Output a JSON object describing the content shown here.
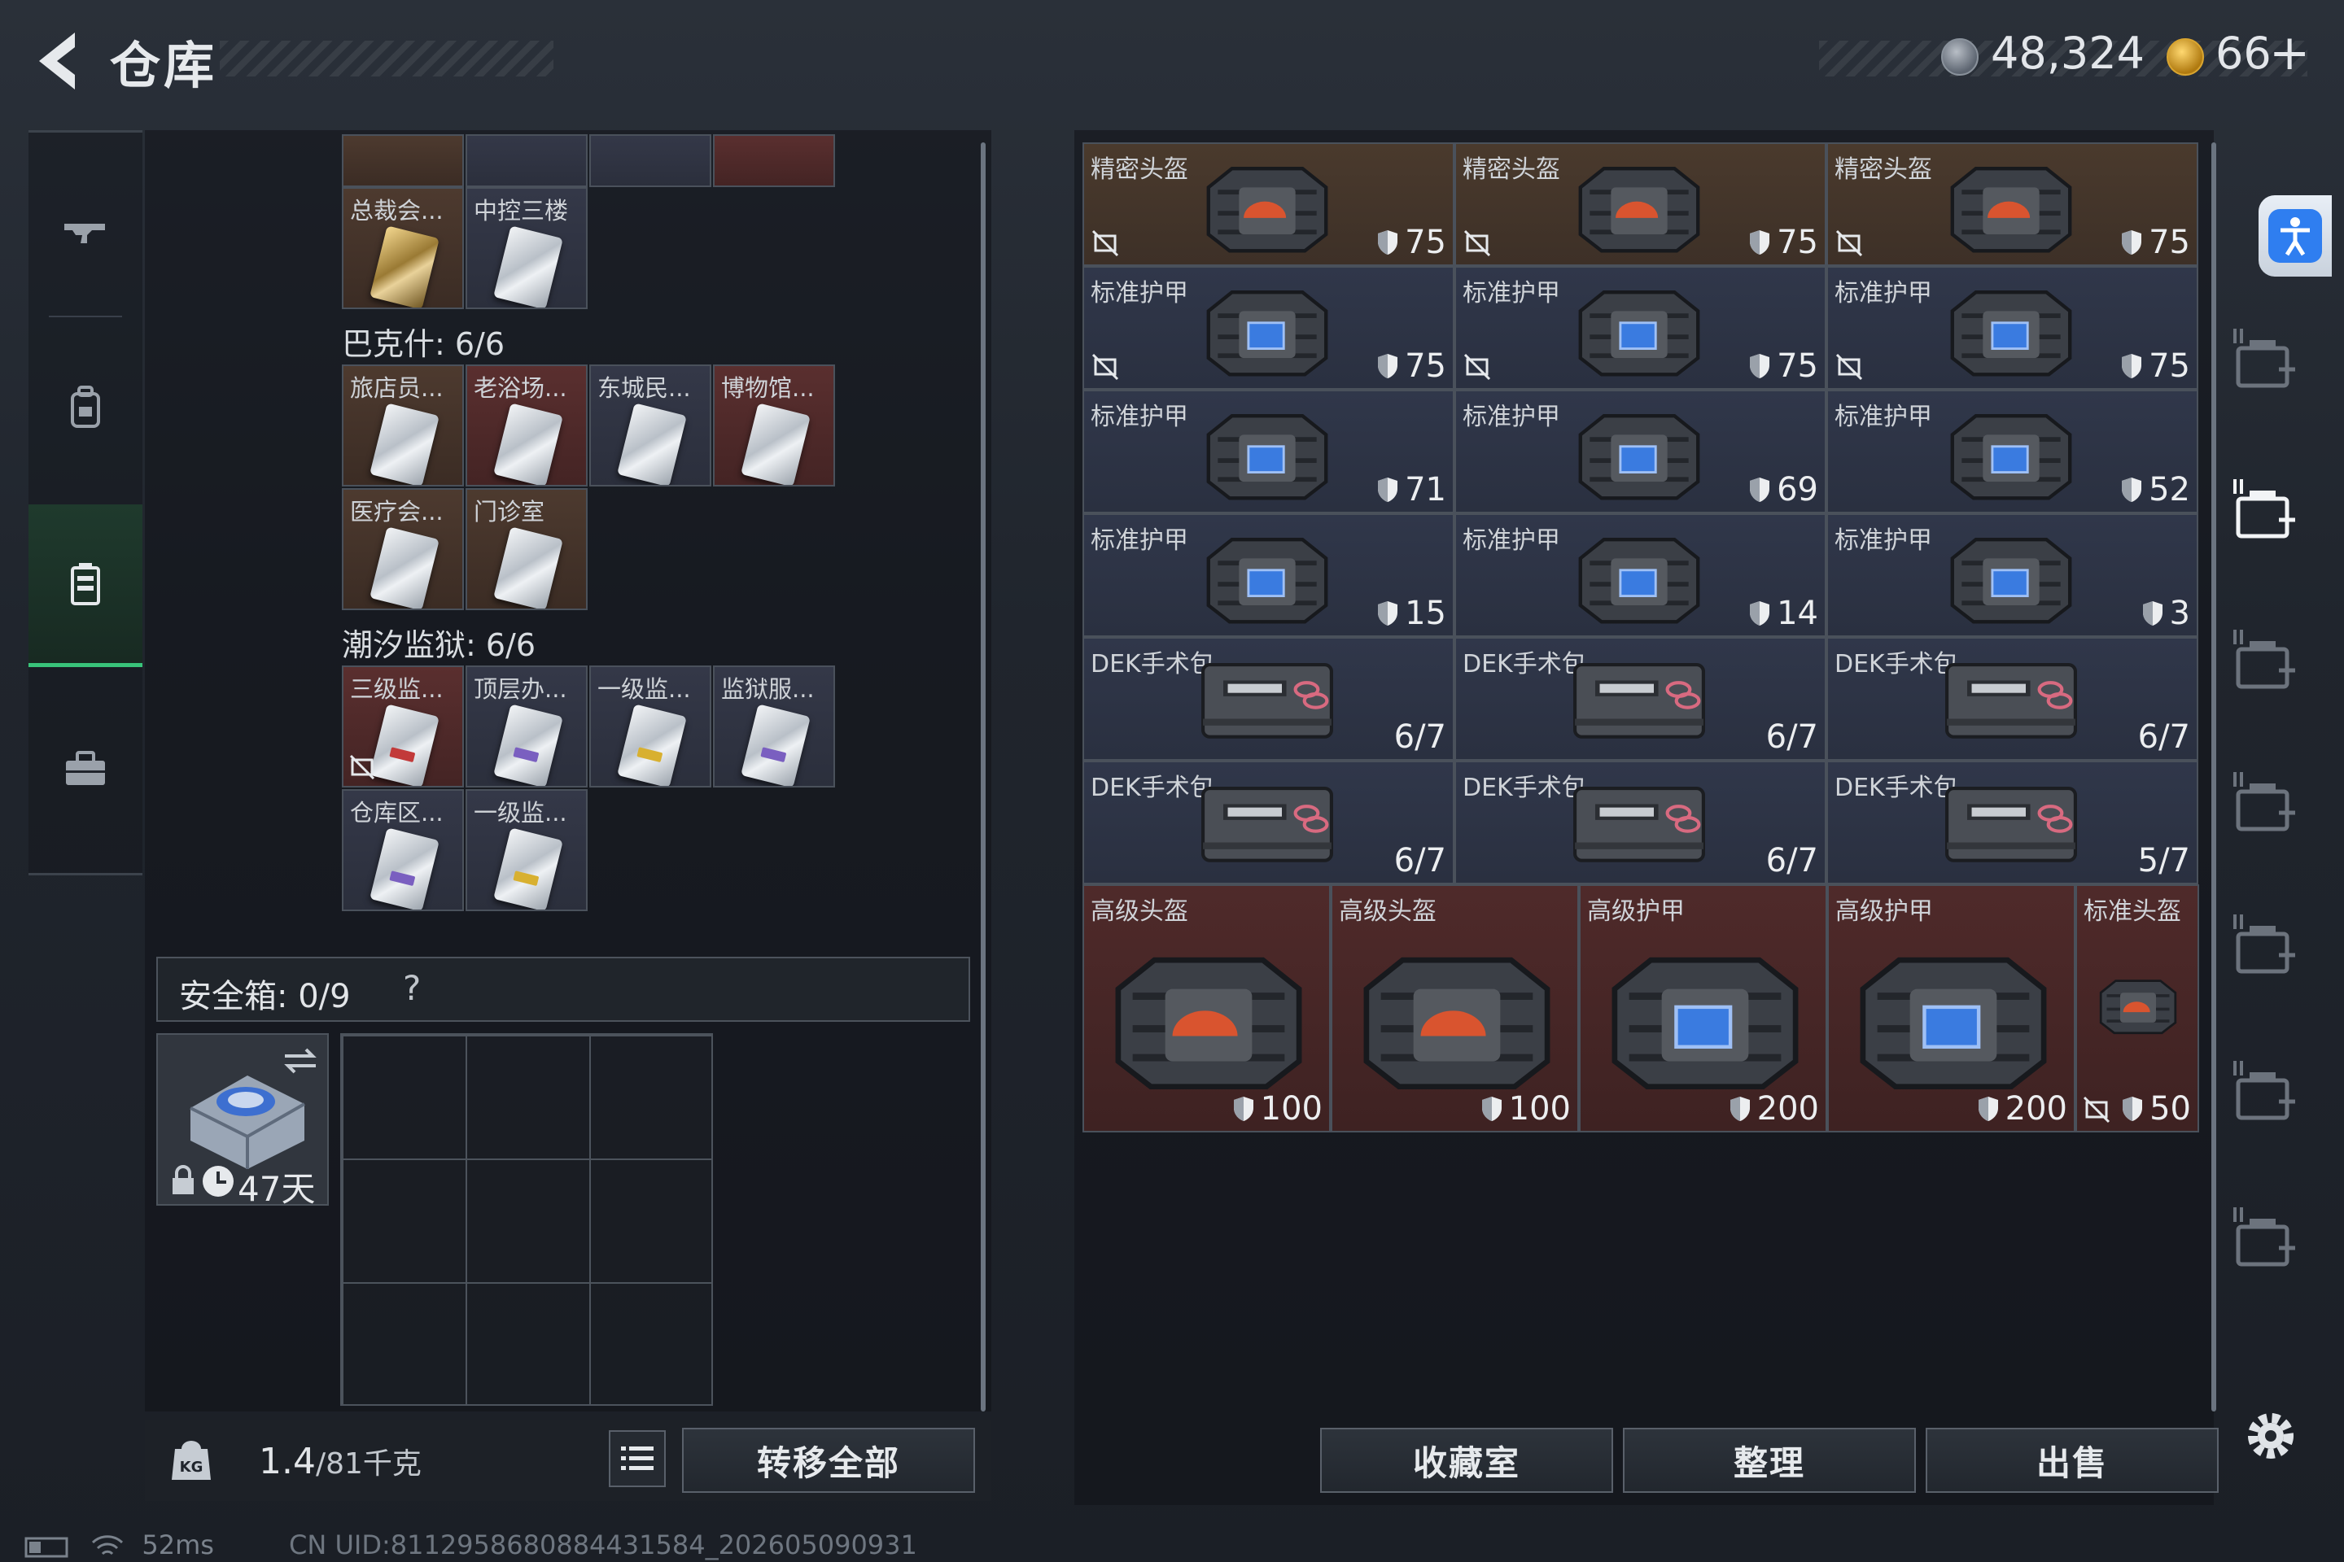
{
  "header": {
    "title": "仓库",
    "currency1": "48,324",
    "currency2": "66",
    "plus_label": "+"
  },
  "left_groups": [
    {
      "title": "",
      "items": [
        {
          "label": "总裁会...",
          "card": "gold",
          "bg": "brown"
        },
        {
          "label": "中控三楼",
          "card": "silver",
          "bg": "blue"
        }
      ]
    },
    {
      "title": "巴克什: 6/6",
      "items": [
        {
          "label": "旅店员...",
          "bg": "brown"
        },
        {
          "label": "老浴场...",
          "bg": "red"
        },
        {
          "label": "东城民...",
          "bg": "blue"
        },
        {
          "label": "博物馆...",
          "bg": "red"
        },
        {
          "label": "医疗会...",
          "bg": "brown"
        },
        {
          "label": "门诊室",
          "bg": "brown"
        }
      ]
    },
    {
      "title": "潮汐监狱: 6/6",
      "items": [
        {
          "label": "三级监...",
          "bg": "red"
        },
        {
          "label": "顶层办...",
          "bg": "blue"
        },
        {
          "label": "一级监...",
          "bg": "blue"
        },
        {
          "label": "监狱服...",
          "bg": "blue"
        },
        {
          "label": "仓库区...",
          "bg": "blue"
        },
        {
          "label": "一级监...",
          "bg": "blue"
        }
      ]
    }
  ],
  "safe_box": {
    "label": "安全箱: 0/9",
    "help": "?",
    "days": "47天"
  },
  "weight": {
    "current": "1.4",
    "max": "/81千克"
  },
  "buttons": {
    "transfer_all": "转移全部",
    "collection": "收藏室",
    "organize": "整理",
    "sell": "出售"
  },
  "stash_items": [
    {
      "name": "精密头盔",
      "value": "75",
      "type": "helmet",
      "bg": "brown"
    },
    {
      "name": "精密头盔",
      "value": "75",
      "type": "helmet",
      "bg": "brown"
    },
    {
      "name": "精密头盔",
      "value": "75",
      "type": "helmet",
      "bg": "brown"
    },
    {
      "name": "标准护甲",
      "value": "75",
      "type": "armor",
      "bg": "blue"
    },
    {
      "name": "标准护甲",
      "value": "75",
      "type": "armor",
      "bg": "blue"
    },
    {
      "name": "标准护甲",
      "value": "75",
      "type": "armor",
      "bg": "blue"
    },
    {
      "name": "标准护甲",
      "value": "71",
      "type": "armor",
      "bg": "blue"
    },
    {
      "name": "标准护甲",
      "value": "69",
      "type": "armor",
      "bg": "blue"
    },
    {
      "name": "标准护甲",
      "value": "52",
      "type": "armor",
      "bg": "blue"
    },
    {
      "name": "标准护甲",
      "value": "15",
      "type": "armor",
      "bg": "blue"
    },
    {
      "name": "标准护甲",
      "value": "14",
      "type": "armor",
      "bg": "blue"
    },
    {
      "name": "标准护甲",
      "value": "3",
      "type": "armor",
      "bg": "blue"
    },
    {
      "name": "DEK手术包",
      "value": "6/7",
      "type": "medkit",
      "bg": "blue"
    },
    {
      "name": "DEK手术包",
      "value": "6/7",
      "type": "medkit",
      "bg": "blue"
    },
    {
      "name": "DEK手术包",
      "value": "6/7",
      "type": "medkit",
      "bg": "blue"
    },
    {
      "name": "DEK手术包",
      "value": "6/7",
      "type": "medkit",
      "bg": "blue"
    },
    {
      "name": "DEK手术包",
      "value": "6/7",
      "type": "medkit",
      "bg": "blue"
    },
    {
      "name": "DEK手术包",
      "value": "5/7",
      "type": "medkit",
      "bg": "blue"
    }
  ],
  "large_items": [
    {
      "name": "高级头盔",
      "value": "100",
      "type": "helmet"
    },
    {
      "name": "高级头盔",
      "value": "100",
      "type": "helmet"
    },
    {
      "name": "高级护甲",
      "value": "200",
      "type": "armor"
    },
    {
      "name": "高级护甲",
      "value": "200",
      "type": "armor"
    }
  ],
  "small_item": {
    "name": "标准头盔",
    "value": "50"
  },
  "status": {
    "ping": "52ms",
    "uid": "CN UID:8112958680884431584_202605090931"
  },
  "colors": {
    "accent_green": "#39c47a",
    "rarity_gold": "#4a3a2d",
    "rarity_blue": "#30374a",
    "rarity_red": "#4f2a2a",
    "access_blue": "#2f7ef0"
  },
  "icons": [
    "back-arrow-icon",
    "rifle-icon",
    "backpack-icon",
    "vest-icon",
    "briefcase-icon",
    "settings-icon",
    "accessibility-icon",
    "weight-kg-icon",
    "list-icon"
  ]
}
